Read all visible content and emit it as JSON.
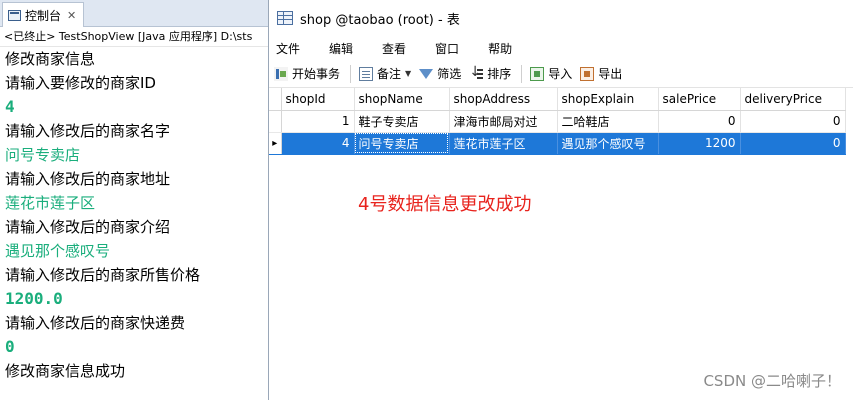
{
  "console": {
    "tab_label": "控制台",
    "status": "<已终止> TestShopView [Java 应用程序] D:\\sts",
    "lines": [
      "修改商家信息",
      "请输入要修改的商家ID",
      "4",
      "请输入修改后的商家名字",
      "问号专卖店",
      "请输入修改后的商家地址",
      "莲花市莲子区",
      "请输入修改后的商家介绍",
      "遇见那个感叹号",
      "请输入修改后的商家所售价格",
      "1200.0",
      "请输入修改后的商家快递费",
      "0",
      "修改商家信息成功"
    ]
  },
  "navicat": {
    "title": "shop @taobao (root) - 表",
    "menu": [
      "文件",
      "编辑",
      "查看",
      "窗口",
      "帮助"
    ],
    "toolbar": {
      "begin_transaction": "开始事务",
      "note": "备注",
      "filter": "筛选",
      "sort": "排序",
      "import": "导入",
      "export": "导出"
    },
    "columns": [
      "shopId",
      "shopName",
      "shopAddress",
      "shopExplain",
      "salePrice",
      "deliveryPrice"
    ],
    "rows": [
      [
        "1",
        "鞋子专卖店",
        "津海市邮局对过",
        "二哈鞋店",
        "0",
        "0"
      ],
      [
        "4",
        "问号专卖店",
        "莲花市莲子区",
        "遇见那个感叹号",
        "1200",
        "0"
      ]
    ],
    "selected_row_marker": "▸",
    "selected_row_index": 1
  },
  "annotation": "4号数据信息更改成功",
  "watermark": "CSDN @二哈喇子！",
  "colors": {
    "console_input_text": "#1aae7c",
    "selection": "#1e78d8",
    "annotation": "#e8231d"
  }
}
